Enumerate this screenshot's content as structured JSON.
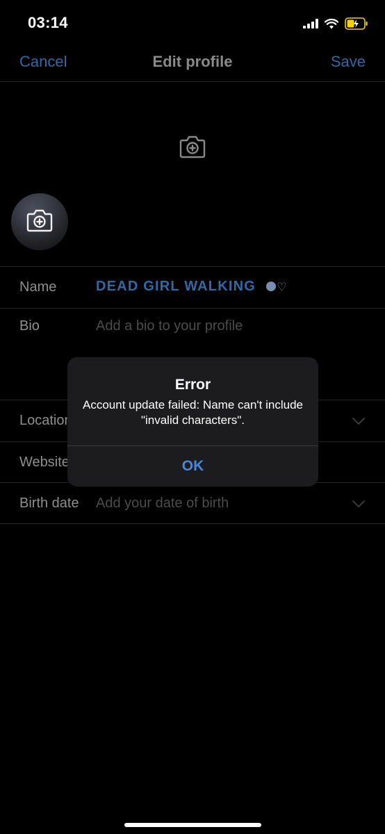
{
  "status_bar": {
    "time": "03:14",
    "icons": [
      "signal-icon",
      "wifi-icon",
      "battery-charging-icon"
    ],
    "battery_color": "#f5d000"
  },
  "nav": {
    "cancel_label": "Cancel",
    "title": "Edit profile",
    "save_label": "Save"
  },
  "header": {
    "banner_icon": "camera-plus-icon",
    "avatar_icon": "camera-plus-icon"
  },
  "form": {
    "name": {
      "label": "Name",
      "value": "DEAD GIRL WALKING",
      "emoji": "🌑♡"
    },
    "bio": {
      "label": "Bio",
      "placeholder": "Add a bio to your profile"
    },
    "location": {
      "label": "Location"
    },
    "website": {
      "label": "Website"
    },
    "birth_date": {
      "label": "Birth date",
      "placeholder": "Add your date of birth"
    }
  },
  "alert": {
    "title": "Error",
    "message": "Account update failed: Name can't include \"invalid characters\".",
    "ok_label": "OK"
  },
  "colors": {
    "accent": "#2f6aa6",
    "alert_button": "#4b87d8",
    "background": "#000000",
    "alert_background": "#1c1c1e"
  }
}
